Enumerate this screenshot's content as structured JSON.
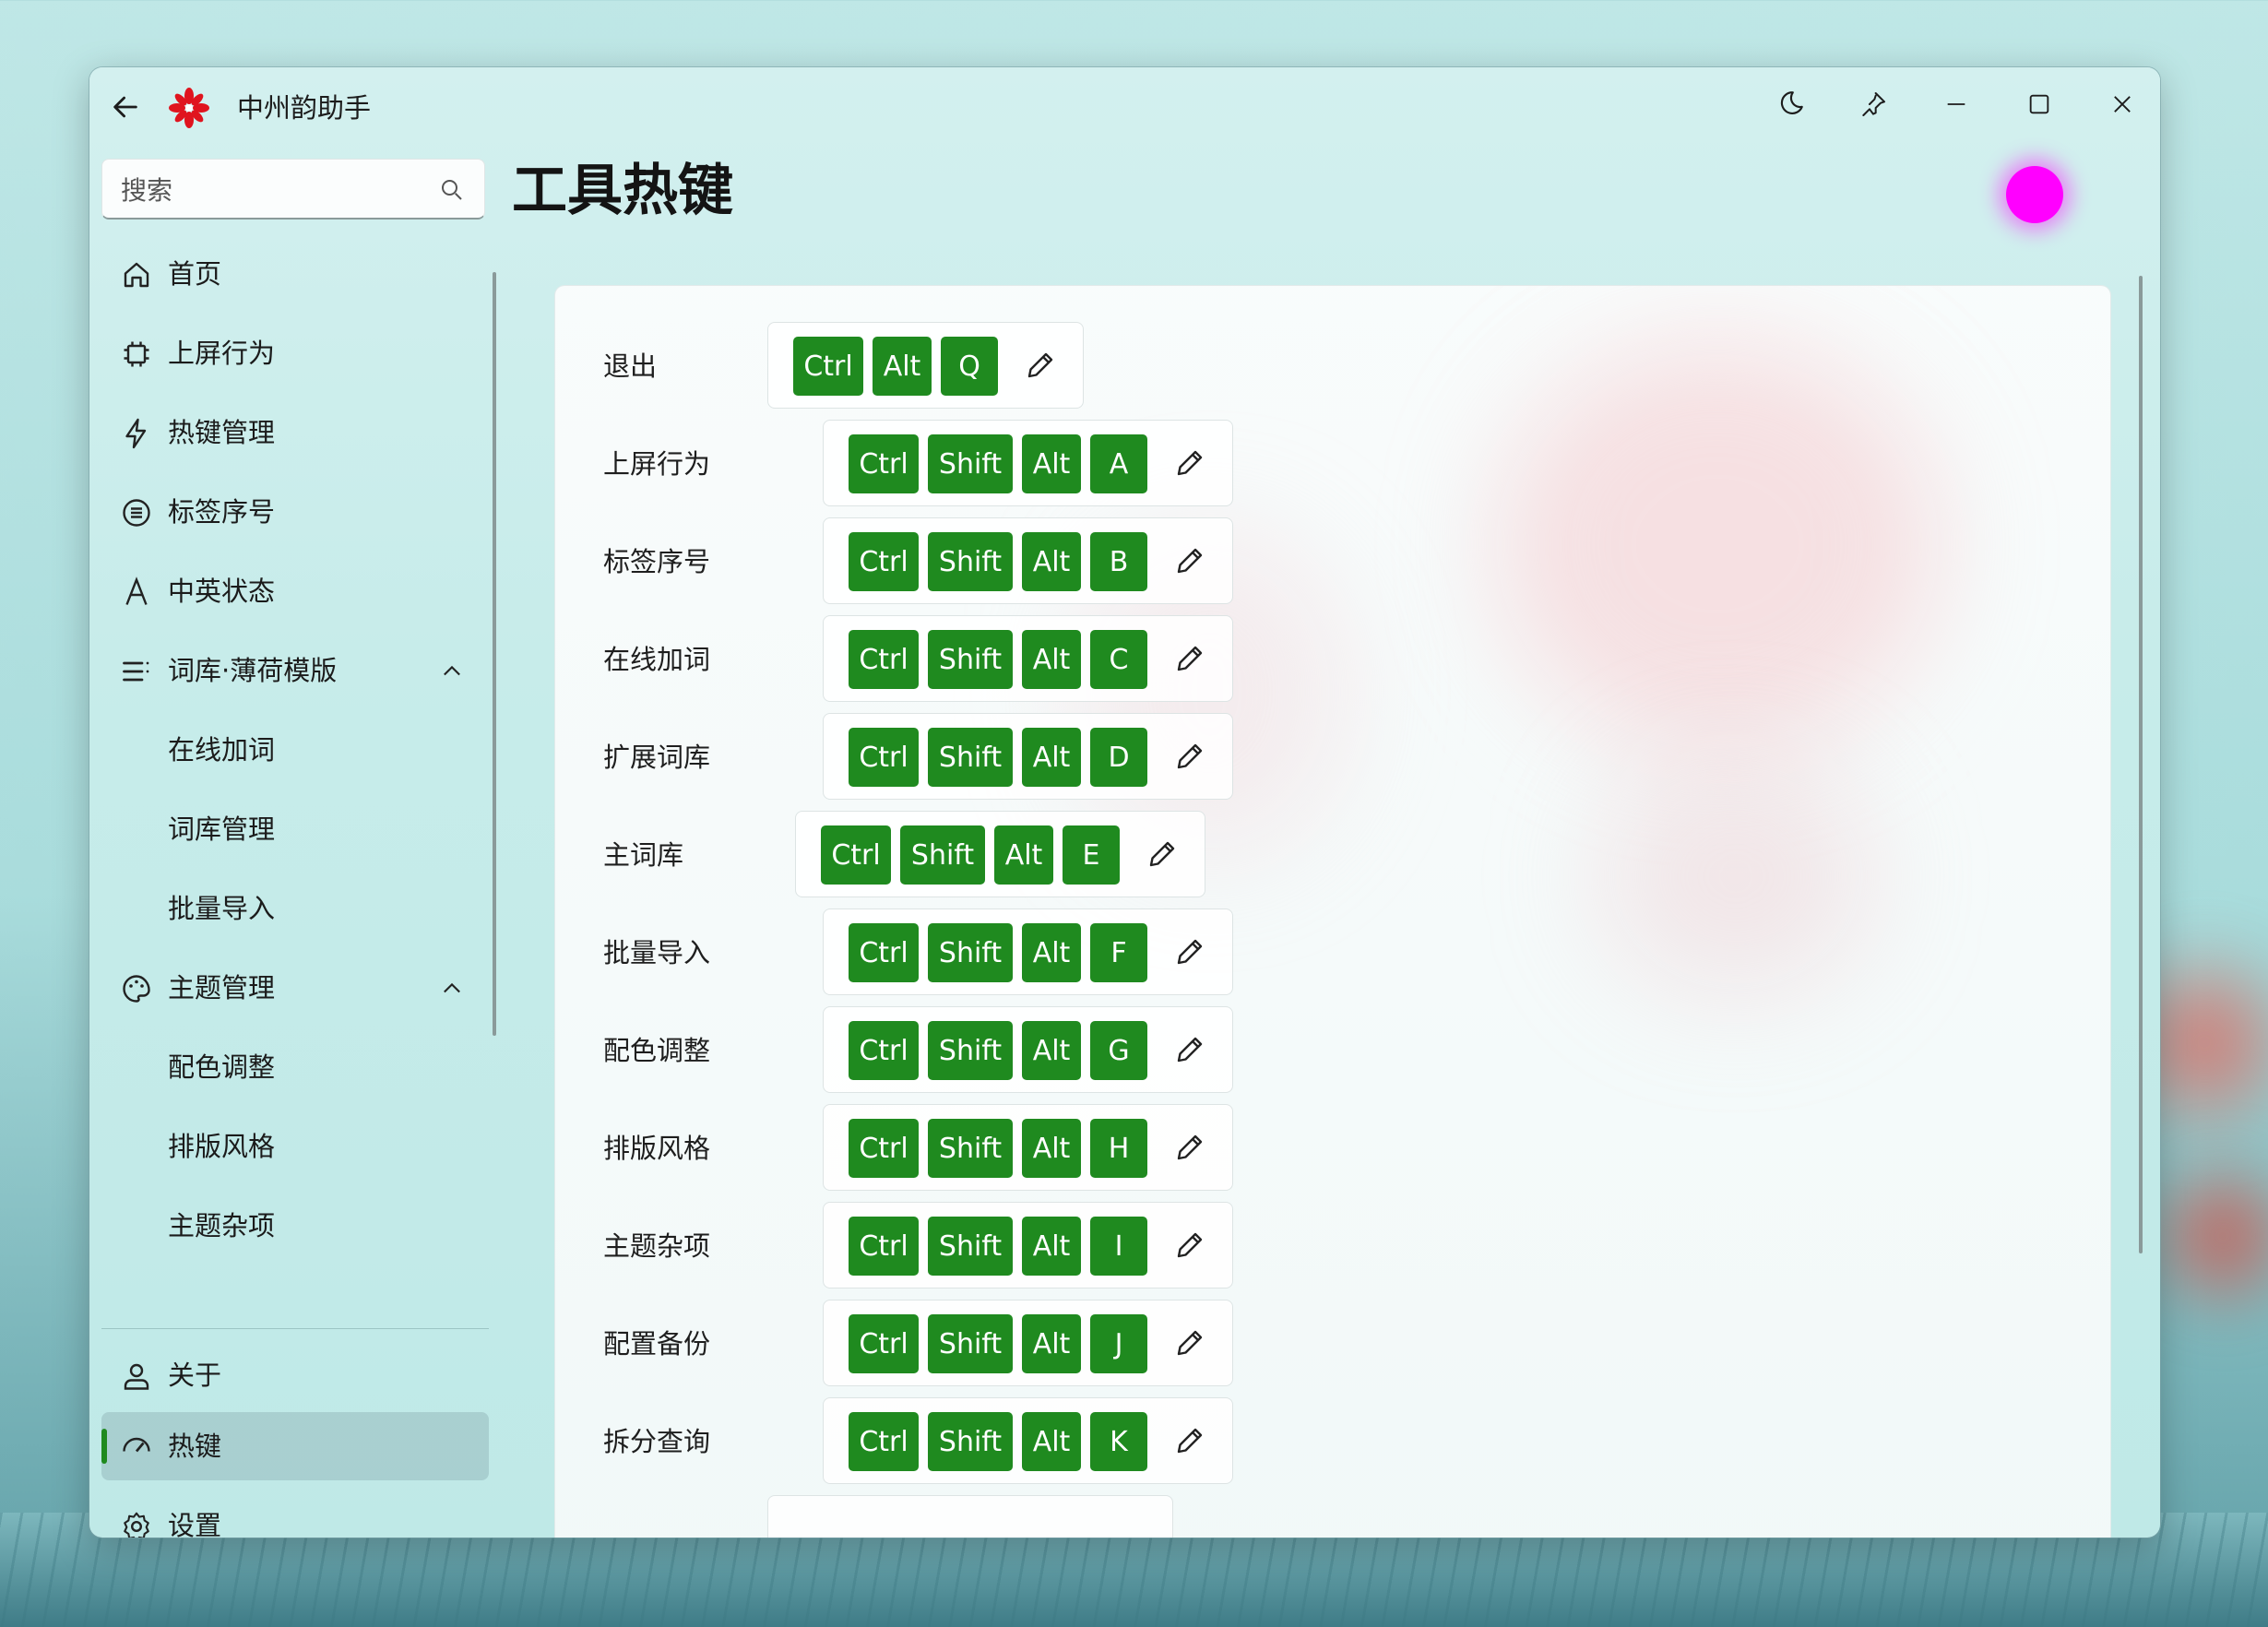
{
  "app": {
    "title": "中州韵助手"
  },
  "search": {
    "placeholder": "搜索"
  },
  "page": {
    "title": "工具热键"
  },
  "colors": {
    "accent": "#1f8a1f",
    "avatar": "#ff00ff"
  },
  "nav": {
    "items": [
      {
        "label": "首页",
        "icon": "home-icon"
      },
      {
        "label": "上屏行为",
        "icon": "chip-icon"
      },
      {
        "label": "热键管理",
        "icon": "lightning-icon"
      },
      {
        "label": "标签序号",
        "icon": "list-circle-icon"
      },
      {
        "label": "中英状态",
        "icon": "letter-a-icon"
      },
      {
        "label": "词库·薄荷模版",
        "icon": "list-icon",
        "expanded": true
      },
      {
        "label": "在线加词",
        "sub": true
      },
      {
        "label": "词库管理",
        "sub": true
      },
      {
        "label": "批量导入",
        "sub": true
      },
      {
        "label": "主题管理",
        "icon": "palette-icon",
        "expanded": true
      },
      {
        "label": "配色调整",
        "sub": true
      },
      {
        "label": "排版风格",
        "sub": true
      },
      {
        "label": "主题杂项",
        "sub": true
      }
    ],
    "footer": [
      {
        "label": "关于",
        "icon": "person-icon"
      },
      {
        "label": "热键",
        "icon": "gauge-icon",
        "active": true
      },
      {
        "label": "设置",
        "icon": "gear-icon"
      }
    ]
  },
  "hotkeys": [
    {
      "label": "退出",
      "keys": [
        "Ctrl",
        "Alt",
        "Q"
      ]
    },
    {
      "label": "上屏行为",
      "keys": [
        "Ctrl",
        "Shift",
        "Alt",
        "A"
      ]
    },
    {
      "label": "标签序号",
      "keys": [
        "Ctrl",
        "Shift",
        "Alt",
        "B"
      ]
    },
    {
      "label": "在线加词",
      "keys": [
        "Ctrl",
        "Shift",
        "Alt",
        "C"
      ]
    },
    {
      "label": "扩展词库",
      "keys": [
        "Ctrl",
        "Shift",
        "Alt",
        "D"
      ]
    },
    {
      "label": "主词库",
      "keys": [
        "Ctrl",
        "Shift",
        "Alt",
        "E"
      ]
    },
    {
      "label": "批量导入",
      "keys": [
        "Ctrl",
        "Shift",
        "Alt",
        "F"
      ]
    },
    {
      "label": "配色调整",
      "keys": [
        "Ctrl",
        "Shift",
        "Alt",
        "G"
      ]
    },
    {
      "label": "排版风格",
      "keys": [
        "Ctrl",
        "Shift",
        "Alt",
        "H"
      ]
    },
    {
      "label": "主题杂项",
      "keys": [
        "Ctrl",
        "Shift",
        "Alt",
        "I"
      ]
    },
    {
      "label": "配置备份",
      "keys": [
        "Ctrl",
        "Shift",
        "Alt",
        "J"
      ]
    },
    {
      "label": "拆分查询",
      "keys": [
        "Ctrl",
        "Shift",
        "Alt",
        "K"
      ]
    }
  ]
}
